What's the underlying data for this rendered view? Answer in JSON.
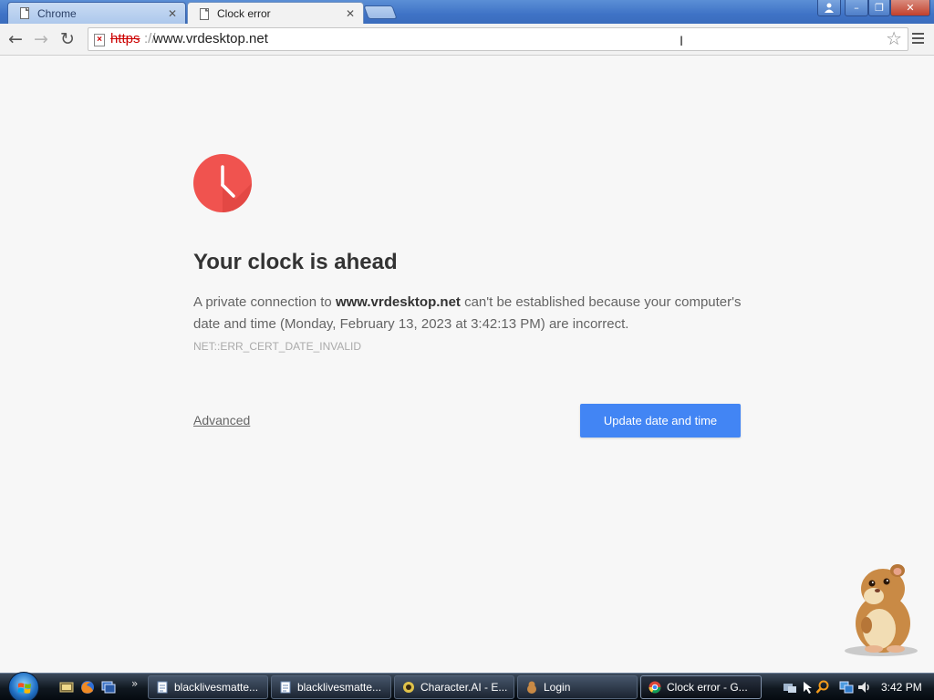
{
  "browser": {
    "tabs": [
      {
        "label": "Chrome",
        "active": false
      },
      {
        "label": "Clock error",
        "active": true
      }
    ],
    "tab_close_glyph": "✕",
    "window_controls": [
      "user-icon",
      "minimize-icon",
      "restore-icon",
      "close-icon"
    ],
    "window_control_glyphs": [
      "",
      "–",
      "❐",
      "✕"
    ],
    "toolbar": {
      "back_glyph": "←",
      "forward_glyph": "→",
      "reload_glyph": "↻",
      "star_glyph": "☆"
    },
    "omnibox": {
      "scheme": "https",
      "separator": "://",
      "host": "www.vrdesktop.net",
      "security_state": "invalid-certificate",
      "security_color": "#cc0000"
    }
  },
  "error_page": {
    "heading": "Your clock is ahead",
    "desc_prefix": "A private connection to ",
    "desc_host": "www.vrdesktop.net",
    "desc_suffix": " can't be established because your computer's date and time (Monday, February 13, 2023 at 3:42:13 PM) are incorrect.",
    "error_code": "NET::ERR_CERT_DATE_INVALID",
    "advanced_link": "Advanced",
    "primary_button": "Update date and time",
    "icon_color": "#f0534f",
    "button_color": "#4285f4"
  },
  "taskbar": {
    "quick_launch": [
      "show-desktop-icon",
      "firefox-icon",
      "switch-windows-icon"
    ],
    "chevron": "»",
    "tasks": [
      {
        "label": "blacklivesmatte...",
        "icon": "document-icon",
        "active": false
      },
      {
        "label": "blacklivesmatte...",
        "icon": "document-icon",
        "active": false
      },
      {
        "label": "Character.AI - E...",
        "icon": "character-ai-icon",
        "active": false
      },
      {
        "label": "Login",
        "icon": "login-icon",
        "active": false
      },
      {
        "label": "Clock error - G...",
        "icon": "chrome-icon",
        "active": true
      }
    ],
    "tray_icons": [
      "network-icon",
      "pointer-icon",
      "search-icon",
      "network-status-icon",
      "volume-icon"
    ],
    "clock": "3:42 PM"
  }
}
